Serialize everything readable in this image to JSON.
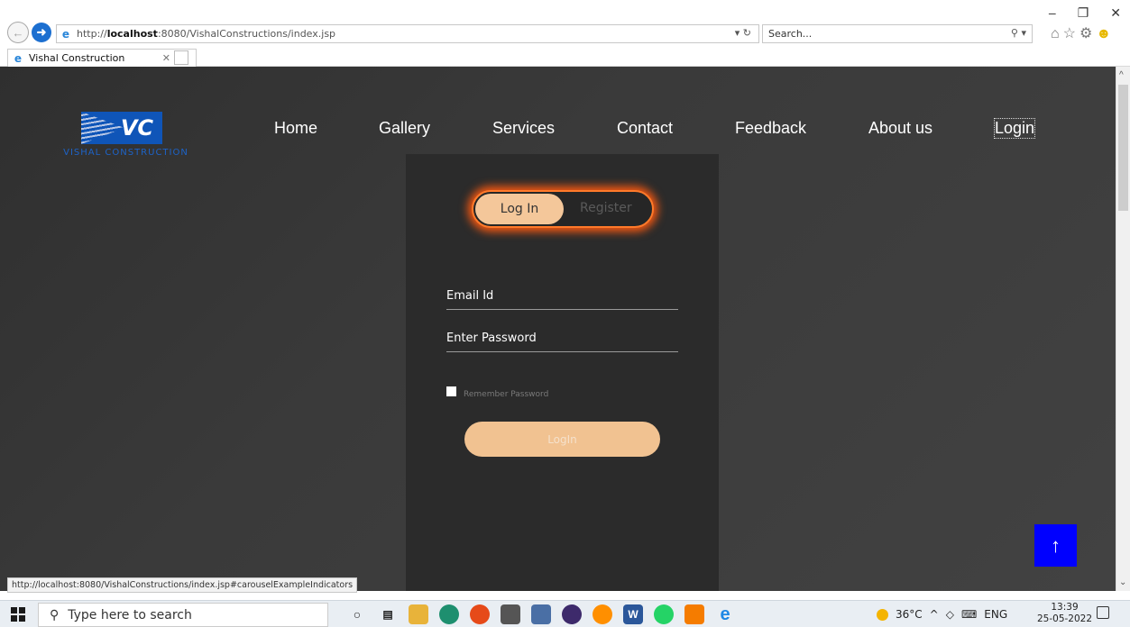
{
  "browser": {
    "url_prefix": "http://",
    "url_host": "localhost",
    "url_rest": ":8080/VishalConstructions/index.jsp",
    "search_placeholder": "Search...",
    "tab_title": "Vishal Construction",
    "status_url": "http://localhost:8080/VishalConstructions/index.jsp#carouselExampleIndicators"
  },
  "site": {
    "logo_text": "VC",
    "logo_subtitle": "VISHAL CONSTRUCTION"
  },
  "nav": {
    "items": [
      {
        "label": "Home"
      },
      {
        "label": "Gallery"
      },
      {
        "label": "Services"
      },
      {
        "label": "Contact"
      },
      {
        "label": "Feedback"
      },
      {
        "label": "About us"
      },
      {
        "label": "Login",
        "active": true
      }
    ]
  },
  "auth": {
    "toggle_login": "Log In",
    "toggle_register": "Register",
    "email_placeholder": "Email Id",
    "password_placeholder": "Enter Password",
    "remember_label": "Remember Password",
    "submit_label": "LogIn"
  },
  "colors": {
    "accent_orange": "#ff7a2a",
    "button_peach": "#f1c291",
    "scroll_top_blue": "#0000ff"
  },
  "taskbar": {
    "search_placeholder": "Type here to search",
    "weather": "36°C",
    "language": "ENG",
    "time": "13:39",
    "date": "25-05-2022"
  }
}
